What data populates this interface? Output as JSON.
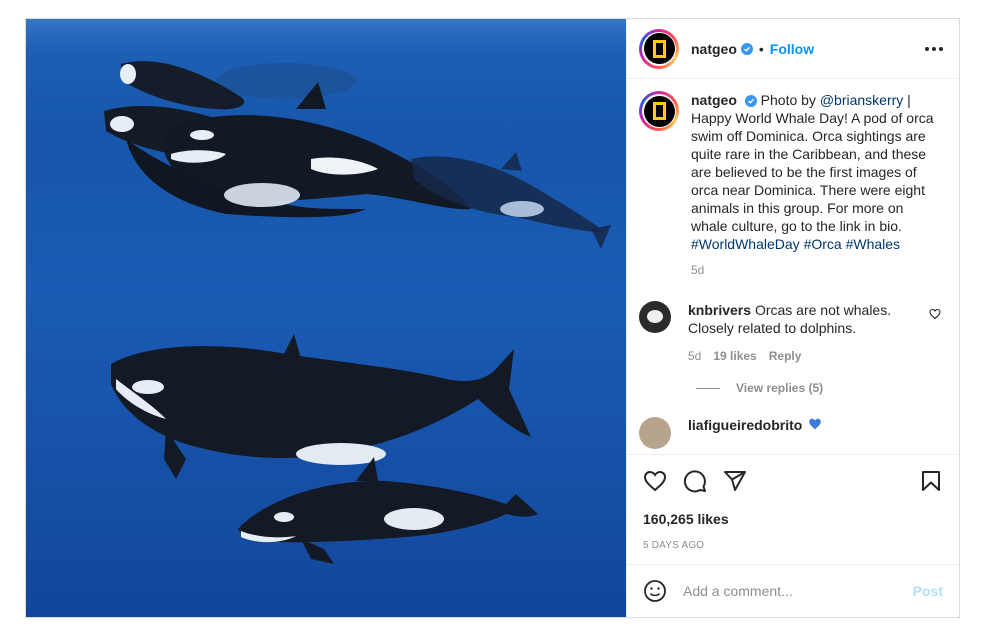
{
  "header": {
    "username": "natgeo",
    "separator": "•",
    "follow_label": "Follow"
  },
  "caption": {
    "username": "natgeo",
    "prefix": "Photo by ",
    "mention": "@brianskerry",
    "text": " | Happy World Whale Day! A pod of orca swim off Dominica. Orca sightings are quite rare in the Caribbean, and these are believed to be the first images of orca near Dominica. There were eight animals in this group. For more on whale culture, go to the link in bio. ",
    "hashtags": [
      "#WorldWhaleDay",
      "#Orca",
      "#Whales"
    ],
    "age": "5d"
  },
  "comments": [
    {
      "username": "knbrivers",
      "text": "Orcas are not whales. Closely related to dolphins.",
      "age": "5d",
      "likes": "19 likes",
      "reply_label": "Reply",
      "view_replies": "View replies (5)"
    },
    {
      "username": "liafigueiredobrito",
      "text": ""
    }
  ],
  "actions": {
    "likes": "160,265 likes",
    "date": "5 DAYS AGO"
  },
  "add_comment": {
    "placeholder": "Add a comment...",
    "post_label": "Post"
  },
  "icons": {
    "like": "heart-icon",
    "comment": "comment-icon",
    "share": "share-icon",
    "save": "bookmark-icon",
    "emoji": "emoji-icon",
    "more": "more-options-icon",
    "verified": "verified-badge-icon"
  },
  "colors": {
    "accent": "#0095f6",
    "link": "#00376b",
    "muted": "#8e8e8e",
    "post_disabled": "#b2dffc",
    "verified": "#3897f0",
    "natgeo_yellow": "#ffce00"
  }
}
